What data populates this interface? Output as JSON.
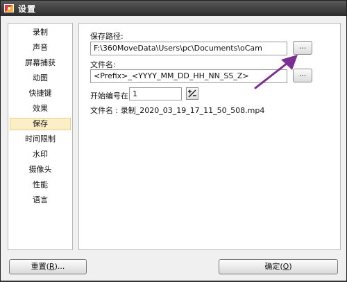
{
  "window": {
    "title": "设置"
  },
  "sidebar": {
    "items": [
      {
        "label": "录制"
      },
      {
        "label": "声音"
      },
      {
        "label": "屏幕捕获"
      },
      {
        "label": "动图"
      },
      {
        "label": "快捷键"
      },
      {
        "label": "效果"
      },
      {
        "label": "保存"
      },
      {
        "label": "时间限制"
      },
      {
        "label": "水印"
      },
      {
        "label": "摄像头"
      },
      {
        "label": "性能"
      },
      {
        "label": "语言"
      }
    ],
    "selected": "保存"
  },
  "save": {
    "path_label": "保存路径:",
    "path_value": "F:\\360MoveData\\Users\\pc\\Documents\\oCam",
    "browse_label": "...",
    "filename_label": "文件名:",
    "filename_value": "<Prefix>_<YYYY_MM_DD_HH_NN_SS_Z>",
    "start_num_label": "开始编号在:",
    "start_num_value": "1",
    "preview_label": "文件名 : 录制_2020_03_19_17_11_50_508.mp4"
  },
  "footer": {
    "reset_text": "重置(",
    "reset_key": "R",
    "reset_suffix": ")...",
    "ok_text": "确定(",
    "ok_key": "O",
    "ok_suffix": ")"
  },
  "colors": {
    "annotation_arrow": "#7b2f93",
    "selected_bg": "#fbefc7"
  }
}
